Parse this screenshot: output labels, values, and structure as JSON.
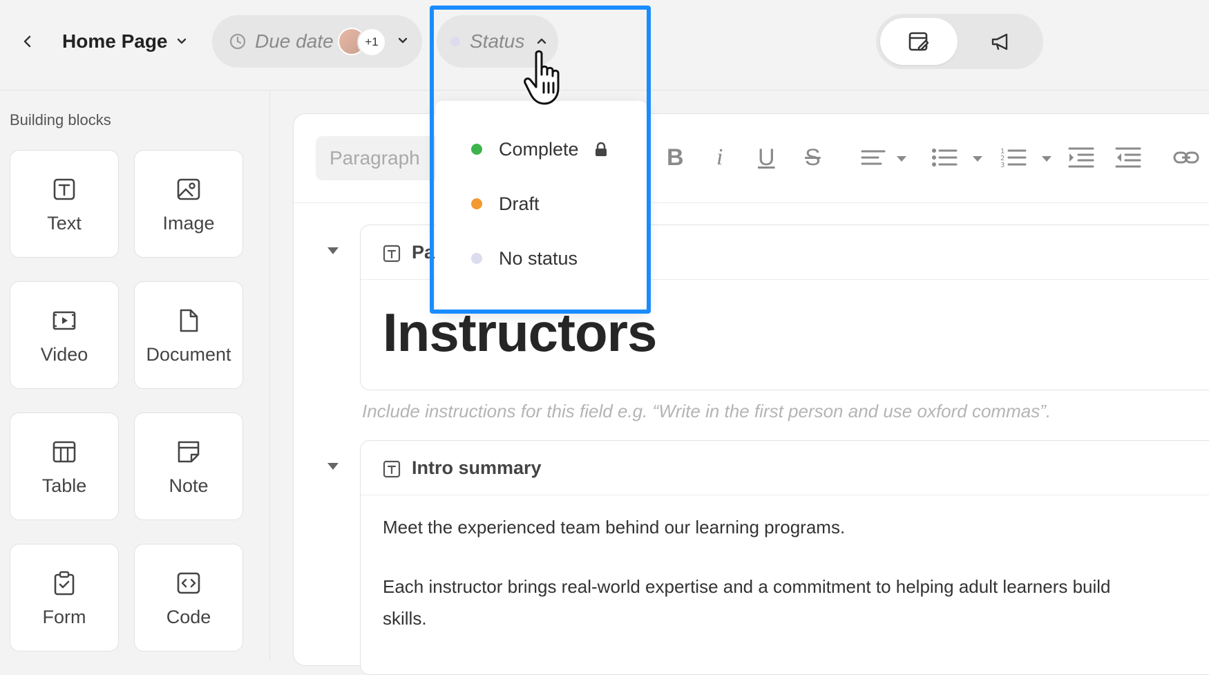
{
  "header": {
    "page_title": "Home Page",
    "due_date_label": "Due date",
    "assignee_extra_count": "+1",
    "status_label": "Status"
  },
  "sidebar": {
    "title": "Building blocks",
    "blocks": [
      {
        "label": "Text",
        "icon": "text-block-icon"
      },
      {
        "label": "Image",
        "icon": "image-block-icon"
      },
      {
        "label": "Video",
        "icon": "video-block-icon"
      },
      {
        "label": "Document",
        "icon": "document-block-icon"
      },
      {
        "label": "Table",
        "icon": "table-block-icon"
      },
      {
        "label": "Note",
        "icon": "note-block-icon"
      },
      {
        "label": "Form",
        "icon": "form-block-icon"
      },
      {
        "label": "Code",
        "icon": "code-block-icon"
      }
    ]
  },
  "toolbar": {
    "paragraph_placeholder": "Paragraph",
    "bold": "B",
    "italic": "i",
    "underline": "U",
    "strike": "S"
  },
  "status_menu": {
    "options": [
      {
        "label": "Complete",
        "color": "#3cb44b",
        "locked": true
      },
      {
        "label": "Draft",
        "color": "#f29a2e",
        "locked": false
      },
      {
        "label": "No status",
        "color": "#dcdcee",
        "locked": false
      }
    ]
  },
  "editor": {
    "field1_partial_label": "Pa",
    "heading": "Instructors",
    "instructions_hint": "Include instructions for this field e.g. “Write in the first person and use oxford commas”.",
    "field2_label": "Intro summary",
    "paragraph1": "Meet the experienced team behind our learning programs.",
    "paragraph2_line1": "Each instructor brings real-world expertise and a commitment to helping adult learners build",
    "paragraph2_line2": "skills."
  },
  "colors": {
    "accent_highlight": "#1a8cff"
  }
}
